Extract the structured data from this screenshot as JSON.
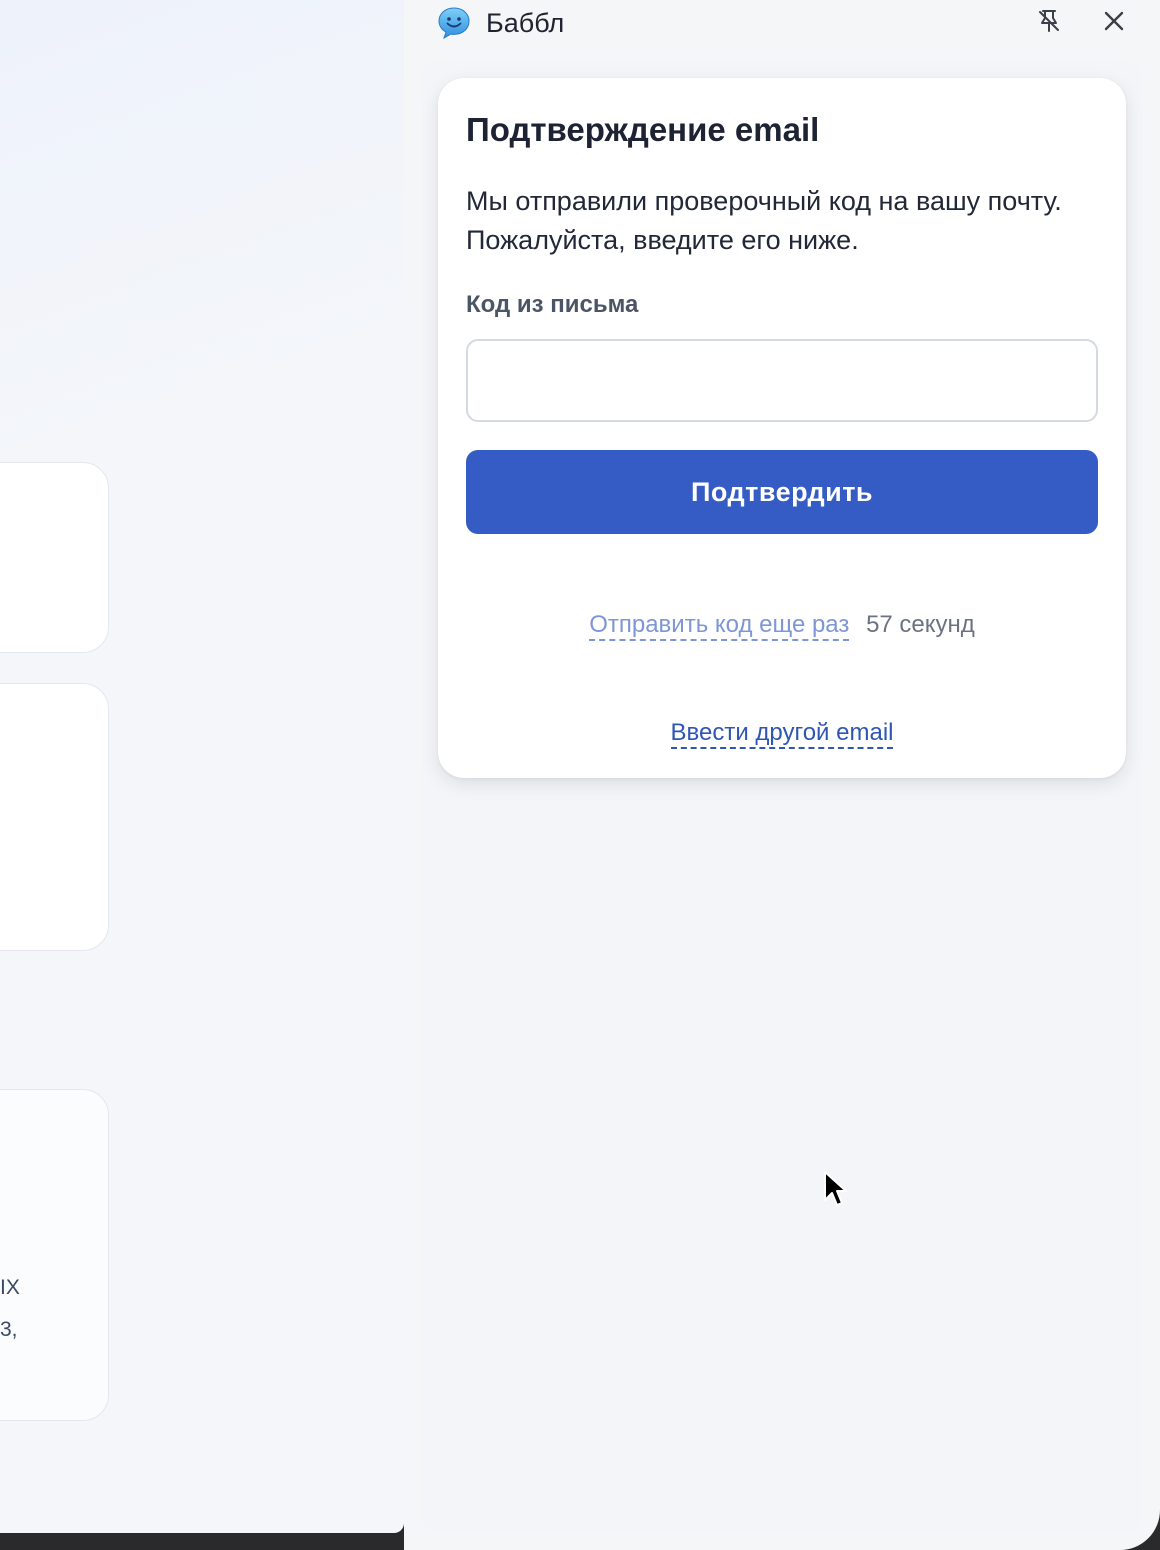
{
  "background_page": {
    "fragment_line_1": "IX",
    "fragment_line_2": "3,"
  },
  "extension": {
    "app_name": "Баббл",
    "logo_icon": "smiling-speech-bubble-icon",
    "pin_icon": "unpin-icon",
    "close_icon": "close-icon"
  },
  "verification": {
    "title": "Подтверждение email",
    "description": "Мы отправили проверочный код на вашу почту. Пожалуйста, введите его ниже.",
    "code_label": "Код из письма",
    "code_value": "",
    "confirm_button": "Подтвердить",
    "resend_link": "Отправить код еще раз",
    "resend_timer": "57 секунд",
    "other_email_link": "Ввести другой email"
  },
  "colors": {
    "accent": "#345cc4",
    "link": "#2f56b6",
    "link_disabled": "#7e96d6"
  }
}
